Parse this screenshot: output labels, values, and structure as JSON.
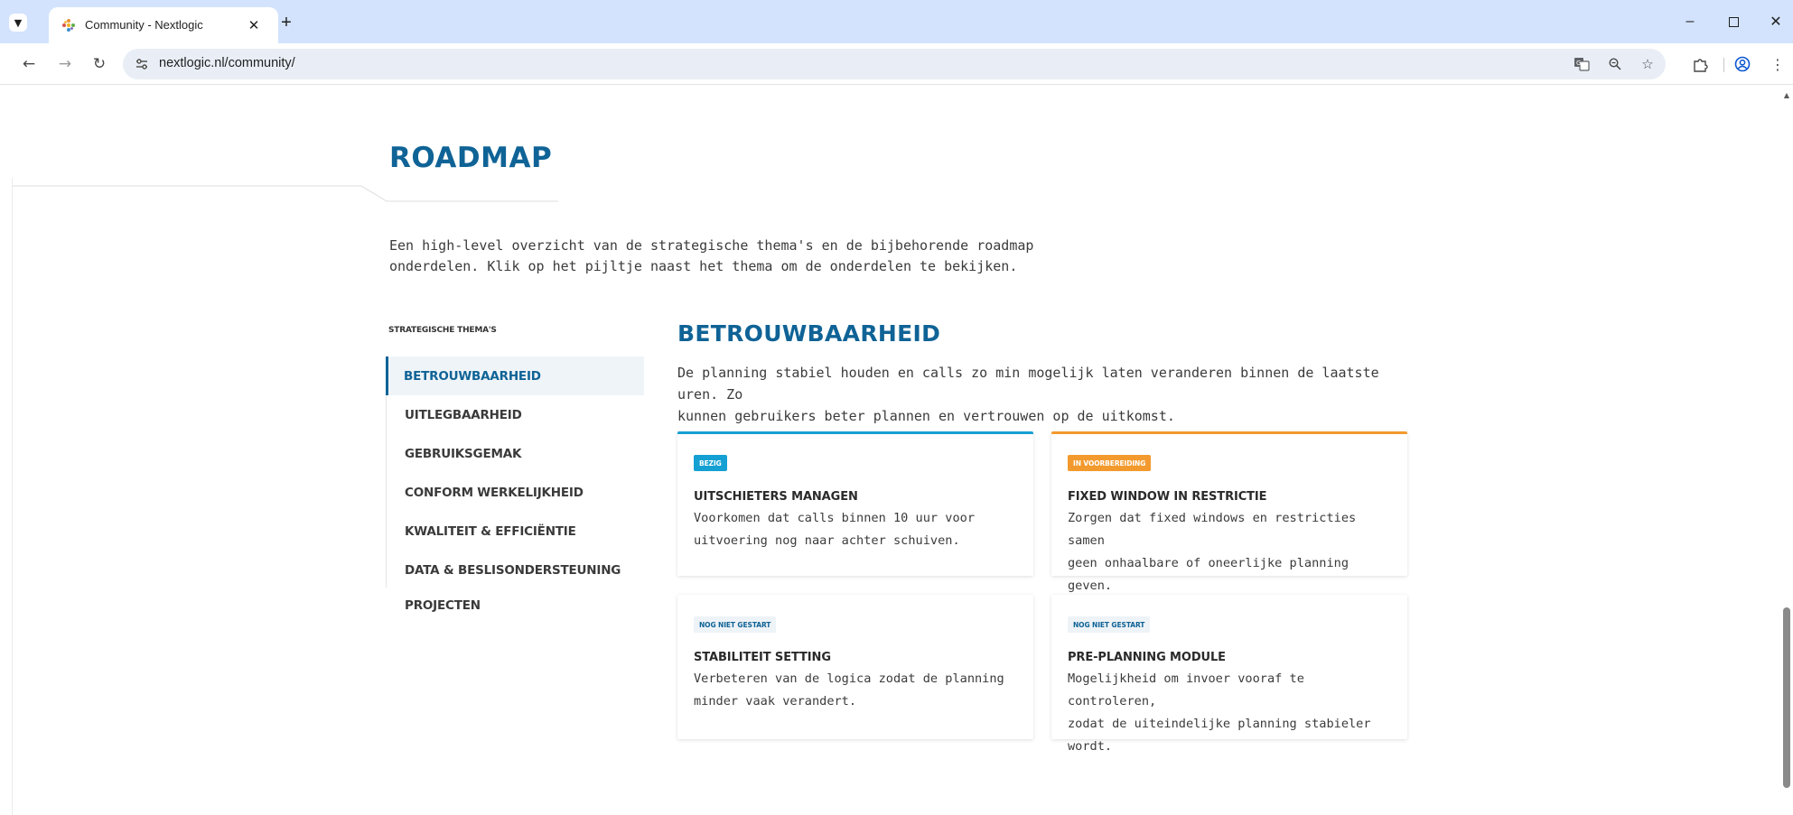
{
  "browser": {
    "tab_title": "Community - Nextlogic",
    "url": "nextlogic.nl/community/"
  },
  "icons": {
    "tab_menu": "chevron-down-icon",
    "tab_close": "close-icon",
    "new_tab": "plus-icon",
    "minimize": "minimize-icon",
    "maximize": "maximize-icon",
    "close_window": "close-icon",
    "back": "arrow-left-icon",
    "forward": "arrow-right-icon",
    "reload": "reload-icon",
    "site_info": "tune-icon",
    "translate": "translate-icon",
    "zoom": "zoom-icon",
    "bookmark": "star-icon",
    "extensions": "puzzle-icon",
    "profile": "profile-icon",
    "menu": "more-vert-icon"
  },
  "colors": {
    "brand_blue": "#0f6396",
    "status_bezig": "#14a0d3",
    "status_voorbereiding": "#f39a2e",
    "status_niet_gestart_bg": "#eef3f7"
  },
  "page": {
    "title": "ROADMAP",
    "intro_line1": "Een high-level overzicht van de strategische thema's en de bijbehorende roadmap",
    "intro_line2": "onderdelen. Klik op het pijltje naast het thema om de onderdelen te bekijken."
  },
  "sidebar": {
    "heading": "STRATEGISCHE THEMA'S",
    "items": [
      {
        "label": "BETROUWBAARHEID",
        "active": true
      },
      {
        "label": "UITLEGBAARHEID",
        "active": false
      },
      {
        "label": "GEBRUIKSGEMAK",
        "active": false
      },
      {
        "label": "CONFORM WERKELIJKHEID",
        "active": false
      },
      {
        "label": "KWALITEIT & EFFICIËNTIE",
        "active": false
      },
      {
        "label": "DATA & BESLISONDERSTEUNING",
        "active": false
      },
      {
        "label": "PROJECTEN",
        "active": false
      }
    ]
  },
  "theme": {
    "title": "BETROUWBAARHEID",
    "desc_line1": "De planning stabiel houden en calls zo min mogelijk laten veranderen binnen de laatste uren. Zo",
    "desc_line2": "kunnen gebruikers beter plannen en vertrouwen op de uitkomst."
  },
  "cards": [
    {
      "status": "BEZIG",
      "title": "UITSCHIETERS MANAGEN",
      "desc_line1": "Voorkomen dat calls binnen 10 uur voor",
      "desc_line2": "uitvoering nog naar achter schuiven."
    },
    {
      "status": "IN VOORBEREIDING",
      "title": "FIXED WINDOW IN RESTRICTIE",
      "desc_line1": "Zorgen dat fixed windows en restricties samen",
      "desc_line2": "geen onhaalbare of oneerlijke planning geven."
    },
    {
      "status": "NOG NIET GESTART",
      "title": "STABILITEIT SETTING",
      "desc_line1": "Verbeteren van de logica zodat de planning",
      "desc_line2": "minder vaak verandert."
    },
    {
      "status": "NOG NIET GESTART",
      "title": "PRE-PLANNING MODULE",
      "desc_line1": "Mogelijkheid om invoer vooraf te controleren,",
      "desc_line2": "zodat de uiteindelijke planning stabieler wordt."
    }
  ]
}
